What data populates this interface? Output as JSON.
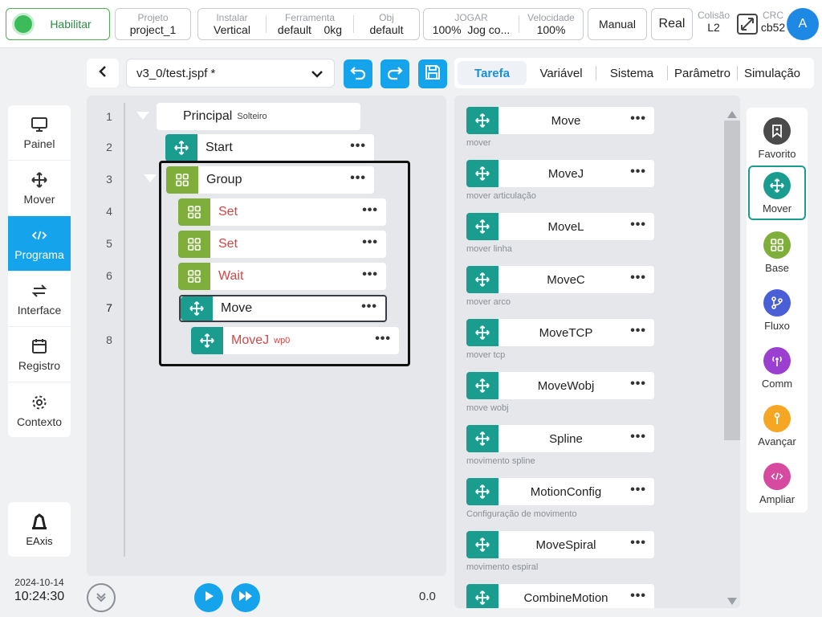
{
  "topbar": {
    "enable_label": "Habilitar",
    "project": {
      "caption": "Projeto",
      "value": "project_1"
    },
    "install": {
      "caption": "Instalar",
      "value": "Vertical"
    },
    "tool": {
      "caption": "Ferramenta",
      "value": "default",
      "weight": "0kg"
    },
    "obj": {
      "caption": "Obj",
      "value": "default"
    },
    "jog": {
      "caption": "JOGAR",
      "percent": "100%",
      "mode": "Jog co..."
    },
    "speed": {
      "caption": "Velocidade",
      "value": "100%"
    },
    "manual_label": "Manual",
    "real_label": "Real",
    "collision": {
      "caption": "Colisão",
      "value": "L2"
    },
    "crc": {
      "caption": "CRC",
      "value": "cb52"
    },
    "avatar_letter": "A"
  },
  "leftnav": {
    "items": [
      {
        "label": "Painel",
        "icon": "monitor-icon"
      },
      {
        "label": "Mover",
        "icon": "move-icon"
      },
      {
        "label": "Programa",
        "icon": "code-icon"
      },
      {
        "label": "Interface",
        "icon": "swap-icon"
      },
      {
        "label": "Registro",
        "icon": "calendar-icon"
      },
      {
        "label": "Contexto",
        "icon": "gear-icon"
      }
    ],
    "eaxis_label": "EAxis",
    "date": "2024-10-14",
    "time": "10:24:30"
  },
  "program": {
    "file_name": "v3_0/test.jspf *",
    "speed_value": "0.0",
    "line_numbers": [
      "1",
      "2",
      "3",
      "4",
      "5",
      "6",
      "7",
      "8"
    ],
    "nodes": [
      {
        "label": "Principal",
        "sub": "Solteiro"
      },
      {
        "label": "Start"
      },
      {
        "label": "Group"
      },
      {
        "label": "Set"
      },
      {
        "label": "Set"
      },
      {
        "label": "Wait"
      },
      {
        "label": "Move"
      },
      {
        "label": "MoveJ",
        "sub": "wp0"
      }
    ]
  },
  "tabs": [
    "Tarefa",
    "Variável",
    "Sistema",
    "Parâmetro",
    "Simulação"
  ],
  "commands": [
    {
      "label": "Move",
      "desc": "mover"
    },
    {
      "label": "MoveJ",
      "desc": "mover articulação"
    },
    {
      "label": "MoveL",
      "desc": "mover linha"
    },
    {
      "label": "MoveC",
      "desc": "mover arco"
    },
    {
      "label": "MoveTCP",
      "desc": "mover tcp"
    },
    {
      "label": "MoveWobj",
      "desc": "move wobj"
    },
    {
      "label": "Spline",
      "desc": "movimento spline"
    },
    {
      "label": "MotionConfig",
      "desc": "Configuração de movimento"
    },
    {
      "label": "MoveSpiral",
      "desc": "movimento espiral"
    },
    {
      "label": "CombineMotion",
      "desc": ""
    }
  ],
  "categories": [
    {
      "label": "Favorito",
      "color": "#4a4a4a"
    },
    {
      "label": "Mover",
      "color": "#1a9d8f"
    },
    {
      "label": "Base",
      "color": "#7fae3a"
    },
    {
      "label": "Fluxo",
      "color": "#4a5fd6"
    },
    {
      "label": "Comm",
      "color": "#9b3fd0"
    },
    {
      "label": "Avançar",
      "color": "#f5a623"
    },
    {
      "label": "Ampliar",
      "color": "#d64aa0"
    }
  ]
}
